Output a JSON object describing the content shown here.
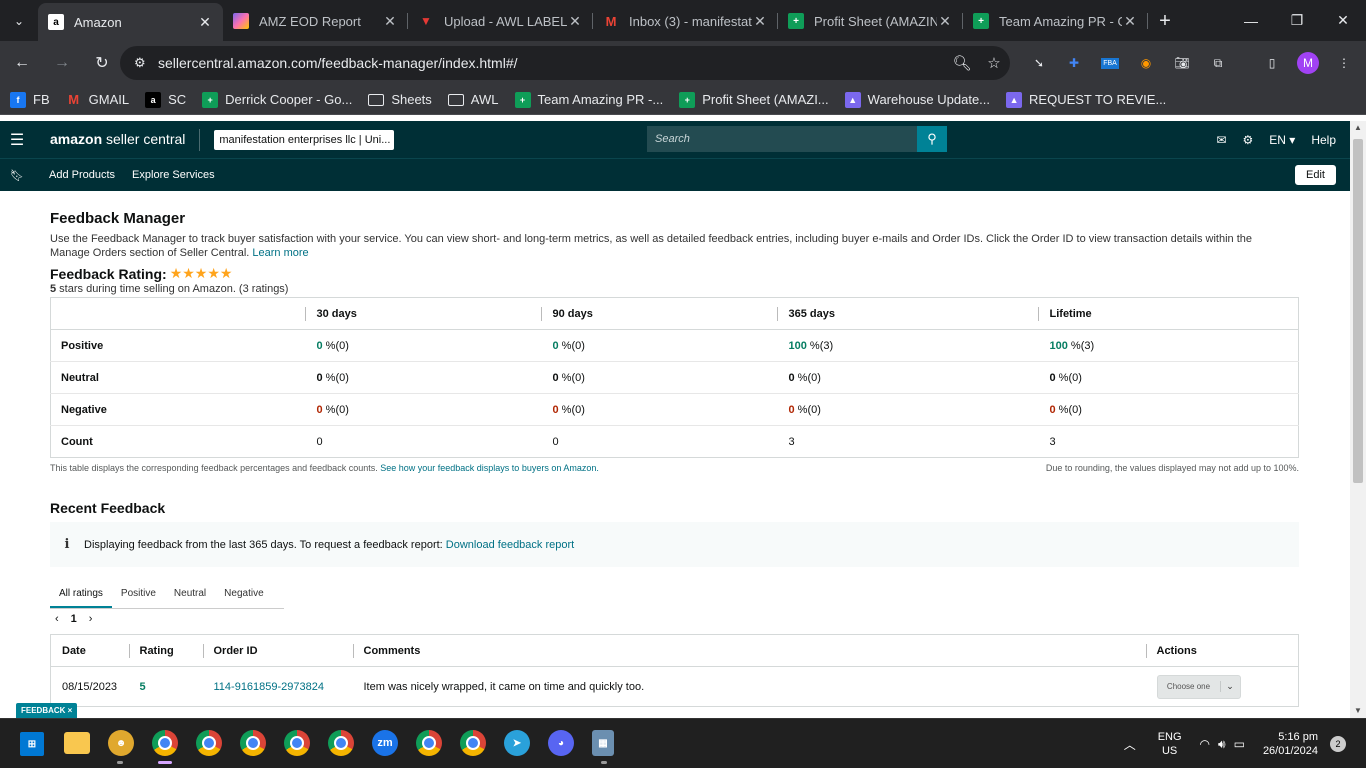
{
  "browser": {
    "tabs": [
      {
        "label": "Amazon",
        "icon": "amazon-icon",
        "active": true
      },
      {
        "label": "AMZ EOD Report",
        "icon": "clickup-icon"
      },
      {
        "label": "Upload - AWL LABEL",
        "icon": "awl-icon"
      },
      {
        "label": "Inbox (3) - manifestat",
        "icon": "gmail-icon"
      },
      {
        "label": "Profit Sheet (AMAZIN",
        "icon": "sheets-icon"
      },
      {
        "label": "Team Amazing PR - G",
        "icon": "sheets-icon"
      }
    ],
    "url": "sellercentral.amazon.com/feedback-manager/index.html#/",
    "profile_initial": "M",
    "bookmarks": [
      {
        "label": "FB",
        "icon": "facebook-icon",
        "color": "#1877f2"
      },
      {
        "label": "GMAIL",
        "icon": "gmail-icon",
        "color": "#ea4335"
      },
      {
        "label": "SC",
        "icon": "amazon-icon",
        "color": "#000000"
      },
      {
        "label": "Derrick Cooper - Go...",
        "icon": "sheets-icon",
        "color": "#0f9d58"
      },
      {
        "label": "Sheets",
        "icon": "folder-icon",
        "color": "#e8eaed"
      },
      {
        "label": "AWL",
        "icon": "folder-icon",
        "color": "#e8eaed"
      },
      {
        "label": "Team Amazing PR -...",
        "icon": "sheets-icon",
        "color": "#0f9d58"
      },
      {
        "label": "Profit Sheet (AMAZI...",
        "icon": "sheets-icon",
        "color": "#0f9d58"
      },
      {
        "label": "Warehouse Update...",
        "icon": "clickup-icon",
        "color": "#7b68ee"
      },
      {
        "label": "REQUEST TO REVIE...",
        "icon": "clickup-icon",
        "color": "#7b68ee"
      }
    ]
  },
  "header": {
    "logo_bold": "amazon",
    "logo_rest": " seller central",
    "account": "manifestation enterprises llc | Uni...",
    "search_placeholder": "Search",
    "lang": "EN",
    "help": "Help",
    "nav": [
      "Add Products",
      "Explore Services"
    ],
    "edit": "Edit"
  },
  "page": {
    "title": "Feedback Manager",
    "intro": "Use the Feedback Manager to track buyer satisfaction with your service. You can view short- and long-term metrics, as well as detailed feedback entries, including buyer e-mails and Order IDs. Click the Order ID to view transaction details within the Manage Orders section of Seller Central.",
    "learn_more": "Learn more",
    "rating_heading": "Feedback Rating:",
    "rating_stars": 5,
    "rating_stars_text": "★★★★★",
    "rating_sub_bold": "5",
    "rating_sub": " stars during time selling on Amazon. (",
    "rating_count": "3",
    "rating_sub_end": " ratings)",
    "metrics": {
      "columns": [
        "30 days",
        "90 days",
        "365 days",
        "Lifetime"
      ],
      "rows": [
        {
          "label": "Positive",
          "cells": [
            [
              "0",
              " %(0)"
            ],
            [
              "0",
              " %(0)"
            ],
            [
              "100",
              " %(3)"
            ],
            [
              "100",
              " %(3)"
            ]
          ],
          "style": "g"
        },
        {
          "label": "Neutral",
          "cells": [
            [
              "0",
              " %(0)"
            ],
            [
              "0",
              " %(0)"
            ],
            [
              "0",
              " %(0)"
            ],
            [
              "0",
              " %(0)"
            ]
          ],
          "style": "n"
        },
        {
          "label": "Negative",
          "cells": [
            [
              "0",
              " %(0)"
            ],
            [
              "0",
              " %(0)"
            ],
            [
              "0",
              " %(0)"
            ],
            [
              "0",
              " %(0)"
            ]
          ],
          "style": "r"
        },
        {
          "label": "Count",
          "cells": [
            [
              "0",
              ""
            ],
            [
              "0",
              ""
            ],
            [
              "3",
              ""
            ],
            [
              "3",
              ""
            ]
          ],
          "style": "plain"
        }
      ]
    },
    "note_left": "This table displays the corresponding feedback percentages and feedback counts.",
    "note_link": "See how your feedback displays to buyers on Amazon.",
    "note_right": "Due to rounding, the values displayed may not add up to 100%.",
    "recent_heading": "Recent Feedback",
    "info_text": "Displaying feedback from the last 365 days. To request a feedback report:",
    "info_link": "Download feedback report",
    "filter_tabs": [
      "All ratings",
      "Positive",
      "Neutral",
      "Negative"
    ],
    "page_number": "1",
    "feedback_columns": [
      "Date",
      "Rating",
      "Order ID",
      "Comments",
      "Actions"
    ],
    "feedback_rows": [
      {
        "date": "08/15/2023",
        "rating": "5",
        "order_id": "114-9161859-2973824",
        "comment": "Item was nicely wrapped, it came on time and quickly too.",
        "action": "Choose one"
      }
    ],
    "feedback_tab": "FEEDBACK ×"
  },
  "taskbar": {
    "lang": "ENG",
    "region": "US",
    "time": "5:16 pm",
    "date": "26/01/2024",
    "notifications": "2"
  }
}
